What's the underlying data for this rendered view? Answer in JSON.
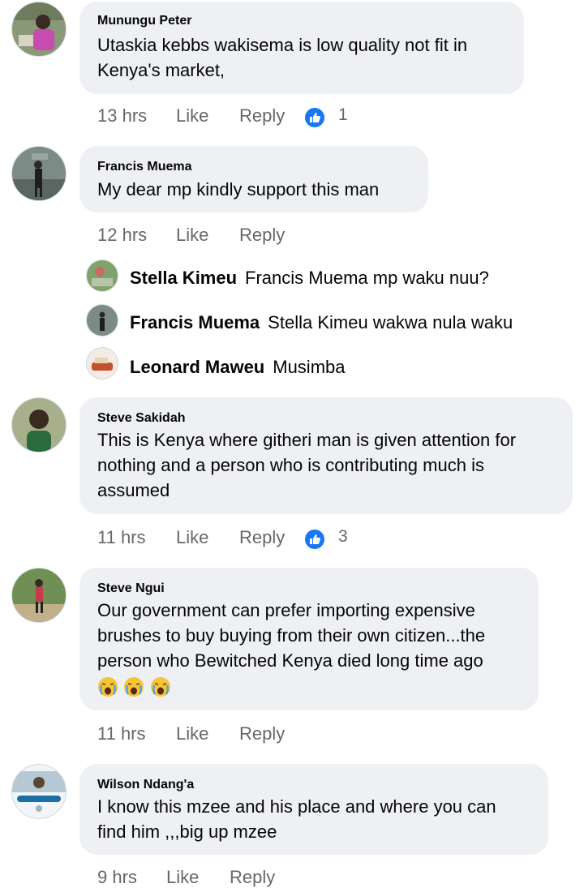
{
  "colors": {
    "bubble": "#eef0f3",
    "meta": "#65676b",
    "like_blue": "#1877f2"
  },
  "comments": [
    {
      "author": "Munungu Peter",
      "text": "Utaskia kebbs wakisema is low quality not fit in\nKenya's market,",
      "time": "13 hrs",
      "like": "Like",
      "reply": "Reply",
      "reactions": "1",
      "avatar_icon": "avatar-photo-icon"
    },
    {
      "author": "Francis Muema",
      "text": "My dear mp kindly support this man",
      "time": "12 hrs",
      "like": "Like",
      "reply": "Reply",
      "avatar_icon": "avatar-photo-icon"
    },
    {
      "author": "Steve Sakidah",
      "text": "This is Kenya where githeri man is given attention for\nnothing and a person who is contributing much is\nassumed",
      "time": "11 hrs",
      "like": "Like",
      "reply": "Reply",
      "reactions": "3",
      "avatar_icon": "avatar-photo-icon"
    },
    {
      "author": "Steve Ngui",
      "text": "Our government can prefer importing expensive\nbrushes to buy buying from their own citizen...the\nperson who Bewitched Kenya died long time ago",
      "emojis": [
        "crying-face-icon",
        "crying-face-icon",
        "crying-face-icon"
      ],
      "time": "11 hrs",
      "like": "Like",
      "reply": "Reply",
      "avatar_icon": "avatar-photo-icon"
    },
    {
      "author": "Wilson Ndang'a",
      "text": "I know this mzee and his place and where you can\nfind him ,,,big up mzee",
      "time": "9 hrs",
      "like": "Like",
      "reply": "Reply",
      "avatar_icon": "avatar-vaccinated-icon"
    }
  ],
  "replies": [
    {
      "name": "Stella Kimeu",
      "text": "Francis Muema mp waku nuu?"
    },
    {
      "name": "Francis Muema",
      "text": "Stella Kimeu wakwa nula waku"
    },
    {
      "name": "Leonard Maweu",
      "text": "Musimba"
    }
  ]
}
